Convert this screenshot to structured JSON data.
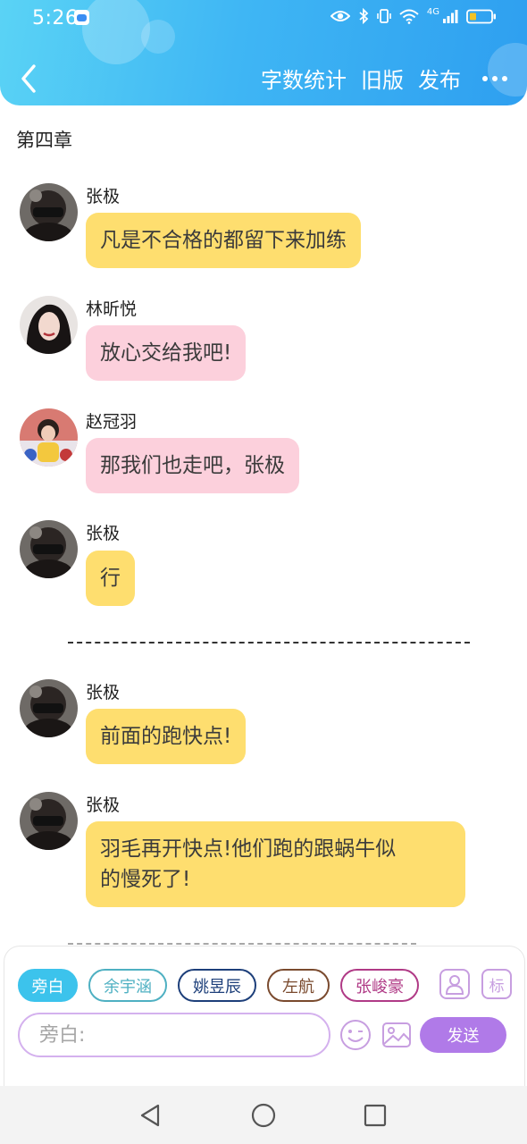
{
  "status_bar": {
    "time": "5:26",
    "network_label": "4G"
  },
  "header": {
    "actions": [
      "字数统计",
      "旧版",
      "发布"
    ]
  },
  "chapter_title": "第四章",
  "messages": [
    {
      "name": "张极",
      "text": "凡是不合格的都留下来加练",
      "color": "yellow"
    },
    {
      "name": "林昕悦",
      "text": "放心交给我吧!",
      "color": "pink"
    },
    {
      "name": "赵冠羽",
      "text": "那我们也走吧，张极",
      "color": "pink"
    },
    {
      "name": "张极",
      "text": "行",
      "color": "yellow"
    },
    {
      "name": "张极",
      "text": "前面的跑快点!",
      "color": "yellow"
    },
    {
      "name": "张极",
      "text": "羽毛再开快点!他们跑的跟蜗牛似的慢死了!",
      "line1": "羽毛再开快点!他们跑的跟蜗牛似",
      "line2": "的慢死了!",
      "color": "yellow"
    }
  ],
  "composer": {
    "roles": [
      "旁白",
      "余宇涵",
      "姚昱辰",
      "左航",
      "张峻豪"
    ],
    "active_role": "旁白",
    "label_button": "标",
    "input_placeholder": "旁白:",
    "send_label": "发送"
  },
  "colors": {
    "header_gradient": [
      "#5ad3f5",
      "#2e9ff0"
    ],
    "bubble_yellow": "#fede6f",
    "bubble_pink": "#fcd0dc",
    "role_colors": [
      "#3cc3ec",
      "#4eb0c2",
      "#1d3f7a",
      "#7a4a2e",
      "#b03a86"
    ],
    "accent_purple": "#b07ae8"
  },
  "icons": [
    "back-arrow-icon",
    "more-dots-icon",
    "eye-icon",
    "bluetooth-icon",
    "vibrate-icon",
    "wifi-icon",
    "signal-icon",
    "battery-icon",
    "contact-icon",
    "emoji-icon",
    "image-icon",
    "nav-back-icon",
    "nav-home-icon",
    "nav-recents-icon"
  ]
}
